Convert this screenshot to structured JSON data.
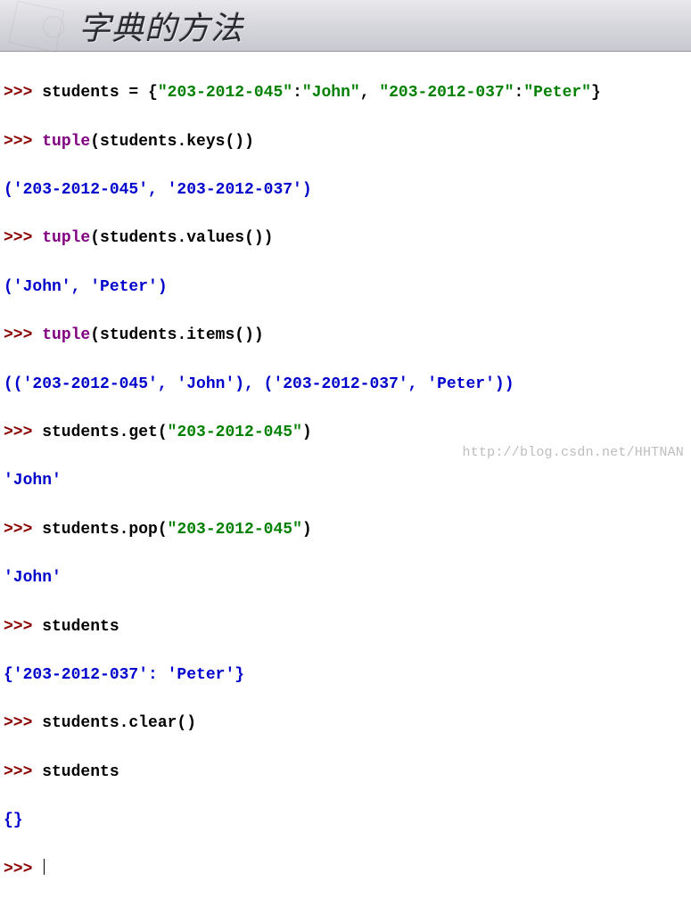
{
  "header": {
    "title": "字典的方法"
  },
  "code": {
    "prompt": ">>>",
    "lines": {
      "l1_assign_a": " students = {",
      "l1_s1": "\"203-2012-045\"",
      "l1_colon1": ":",
      "l1_v1": "\"John\"",
      "l1_comma": ", ",
      "l1_s2": "\"203-2012-037\"",
      "l1_colon2": ":",
      "l1_v2": "\"Peter\"",
      "l1_close": "}",
      "l2_kw": "tuple",
      "l2_rest": "(students.keys())",
      "l3_out": "('203-2012-045', '203-2012-037')",
      "l4_kw": "tuple",
      "l4_rest": "(students.values())",
      "l5_out": "('John', 'Peter')",
      "l6_kw": "tuple",
      "l6_rest": "(students.items())",
      "l7_out": "(('203-2012-045', 'John'), ('203-2012-037', 'Peter'))",
      "l8_a": " students.get(",
      "l8_s": "\"203-2012-045\"",
      "l8_b": ")",
      "l9_out": "'John'",
      "l10_a": " students.pop(",
      "l10_s": "\"203-2012-045\"",
      "l10_b": ")",
      "l11_out": "'John'",
      "l12": " students",
      "l13_out": "{'203-2012-037': 'Peter'}",
      "l14": " students.clear()",
      "l15": " students",
      "l16_out": "{}"
    }
  },
  "watermark": "http://blog.csdn.net/HHTNAN"
}
